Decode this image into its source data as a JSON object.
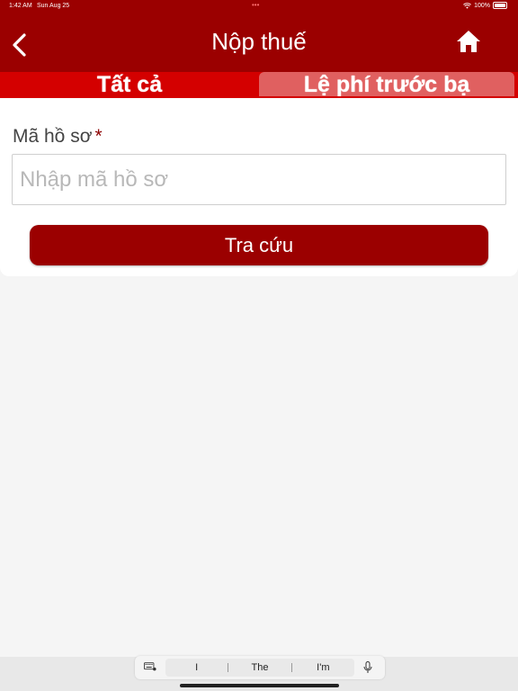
{
  "status_bar": {
    "time": "1:42 AM",
    "date": "Sun Aug 25",
    "battery": "100%"
  },
  "header": {
    "title": "Nộp thuế",
    "back_icon": "chevron-left-icon",
    "home_icon": "home-icon"
  },
  "tabs": [
    {
      "label": "Tất cả",
      "selected": true
    },
    {
      "label": "Lệ phí trước bạ",
      "selected": false
    }
  ],
  "form": {
    "label": "Mã hồ sơ",
    "required_mark": "*",
    "input_value": "",
    "input_placeholder": "Nhập mã hồ sơ",
    "submit_label": "Tra cứu"
  },
  "keyboard": {
    "suggestions": [
      "I",
      "The",
      "I'm"
    ]
  },
  "colors": {
    "primary": "#9b0000",
    "tab_bar": "#d40000",
    "tab_selected_bg": "#e06060",
    "background": "#f5f5f5"
  }
}
